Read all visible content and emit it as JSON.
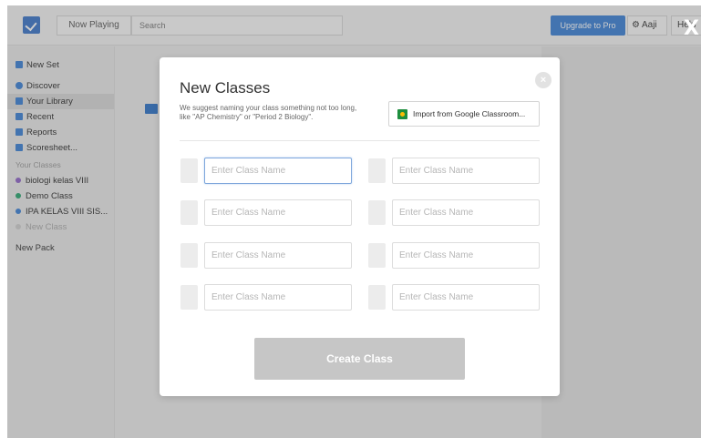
{
  "topbar": {
    "now_playing": "Now Playing",
    "search_placeholder": "Search",
    "upgrade_label": "Upgrade to Pro",
    "user_label": "Aaji",
    "help_label": "Help"
  },
  "sidebar": {
    "items": [
      {
        "label": "New Set",
        "icon": "new-set-icon",
        "color": "#3a80d6"
      },
      {
        "label": "Discover",
        "icon": "discover-icon",
        "color": "#3a80d6"
      },
      {
        "label": "Your Library",
        "icon": "library-icon",
        "color": "#3a80d6"
      },
      {
        "label": "Recent",
        "icon": "recent-icon",
        "color": "#3a80d6"
      },
      {
        "label": "Reports",
        "icon": "reports-icon",
        "color": "#3a80d6"
      },
      {
        "label": "Scoresheet...",
        "icon": "scoresheet-icon",
        "color": "#3a80d6"
      }
    ],
    "classes_heading": "Your Classes",
    "classes": [
      {
        "label": "biologi kelas VIII",
        "color": "#8e63c7"
      },
      {
        "label": "Demo Class",
        "color": "#27a56f"
      },
      {
        "label": "IPA KELAS VIII SIS...",
        "color": "#3a80d6"
      }
    ],
    "new_class": "New Class",
    "new_pack": "New Pack"
  },
  "modal": {
    "title": "New Classes",
    "subtitle": "We suggest naming your class something not too long, like \"AP Chemistry\" or \"Period 2 Biology\".",
    "import_label": "Import from Google Classroom...",
    "input_placeholder": "Enter Class Name",
    "create_label": "Create Class",
    "close_icon": "close-icon"
  },
  "overlay": {
    "close_glyph": "X"
  }
}
